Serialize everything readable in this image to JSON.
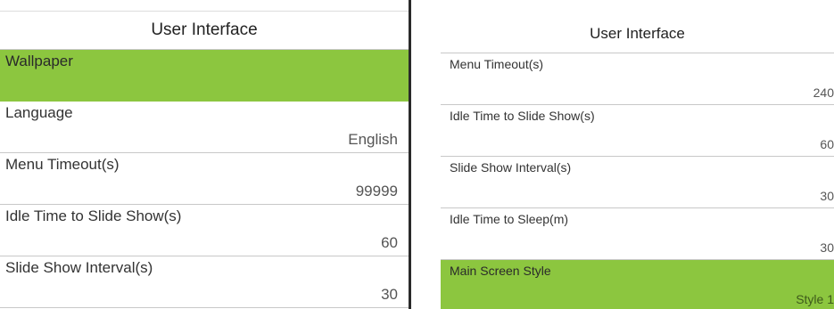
{
  "left_panel": {
    "title": "User Interface",
    "items": [
      {
        "label": "Wallpaper",
        "value": ""
      },
      {
        "label": "Language",
        "value": "English"
      },
      {
        "label": "Menu Timeout(s)",
        "value": "99999"
      },
      {
        "label": "Idle Time to Slide Show(s)",
        "value": "60"
      },
      {
        "label": "Slide Show Interval(s)",
        "value": "30"
      }
    ]
  },
  "right_panel": {
    "title": "User Interface",
    "items": [
      {
        "label": "Menu Timeout(s)",
        "value": "240"
      },
      {
        "label": "Idle Time to Slide Show(s)",
        "value": "60"
      },
      {
        "label": "Slide Show Interval(s)",
        "value": "30"
      },
      {
        "label": "Idle Time to Sleep(m)",
        "value": "30"
      },
      {
        "label": "Main Screen Style",
        "value": "Style 1"
      }
    ]
  },
  "colors": {
    "selected": "#8cc63f"
  }
}
